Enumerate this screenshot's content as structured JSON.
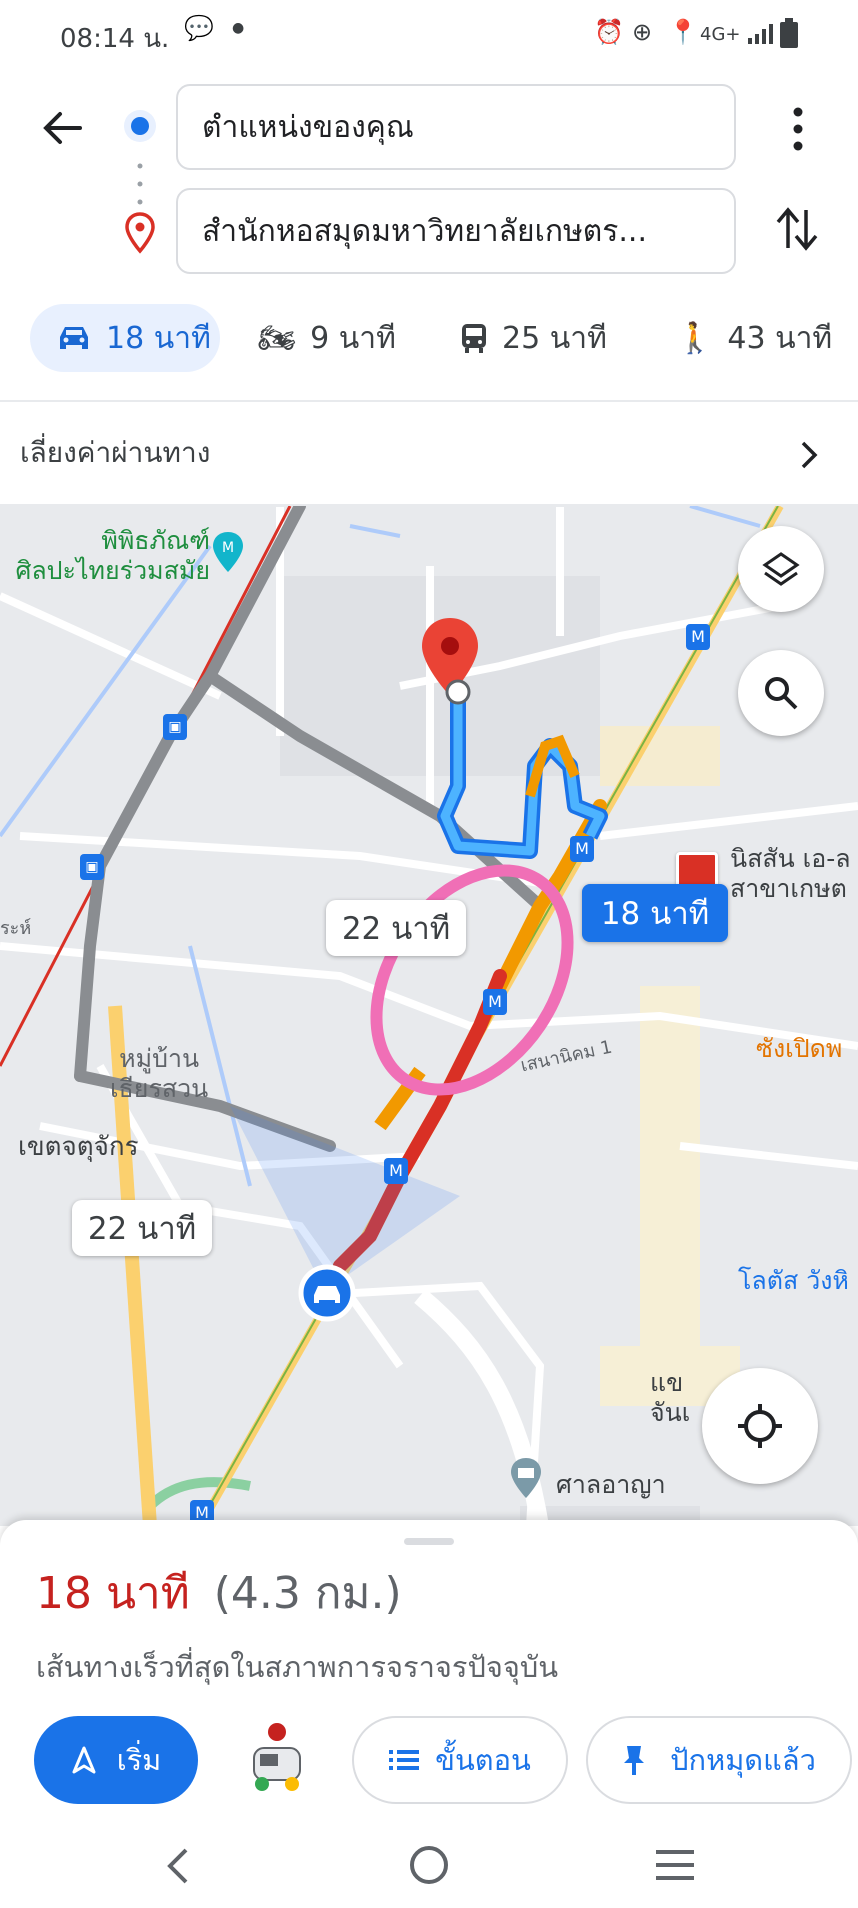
{
  "status_bar": {
    "time": "08:14 น.",
    "network": "4G+"
  },
  "route": {
    "origin": "ตำแหน่งของคุณ",
    "destination": "สำนักหอสมุดมหาวิทยาลัยเกษตร..."
  },
  "modes": [
    {
      "icon": "car-icon",
      "label": "18 นาที",
      "selected": true
    },
    {
      "icon": "motorcycle-icon",
      "label": "9 นาที",
      "selected": false
    },
    {
      "icon": "transit-icon",
      "label": "25 นาที",
      "selected": false
    },
    {
      "icon": "walk-icon",
      "label": "43 นาที",
      "selected": false
    }
  ],
  "toll_option": "เลี่ยงค่าผ่านทาง",
  "map": {
    "labels": {
      "museum": "พิพิธภัณฑ์\nศิลปะไทยร่วมสมัย",
      "nissan": "นิสสัน เอ-ล\nสาขาเกษต",
      "village": "หมู่บ้าน\nเธียรสวน",
      "district": "เขตจตุจักร",
      "road": "เสนานิคม 1",
      "market": "ซังเปิดพ",
      "lotus": "โลตัส วังหิ",
      "court": "ศาลอาญา",
      "partial": "แข\nจันเ",
      "road_left": "ระห์"
    },
    "route_time_primary": "18 นาที",
    "alt_time_1": "22 นาที",
    "alt_time_2": "22 นาที"
  },
  "sheet": {
    "duration": "18 นาที",
    "distance": "(4.3 กม.)",
    "description": "เส้นทางเร็วที่สุดในสภาพการจราจรปัจจุบัน",
    "start_label": "เริ่ม",
    "steps_label": "ขั้นตอน",
    "pinned_label": "ปักหมุดแล้ว"
  },
  "colors": {
    "accent": "#1a73e8",
    "duration_red": "#c5221f",
    "route_blue": "#1a73e8",
    "traffic_orange": "#f29900",
    "traffic_red": "#d93025",
    "annotation_pink": "#f06fb6"
  }
}
